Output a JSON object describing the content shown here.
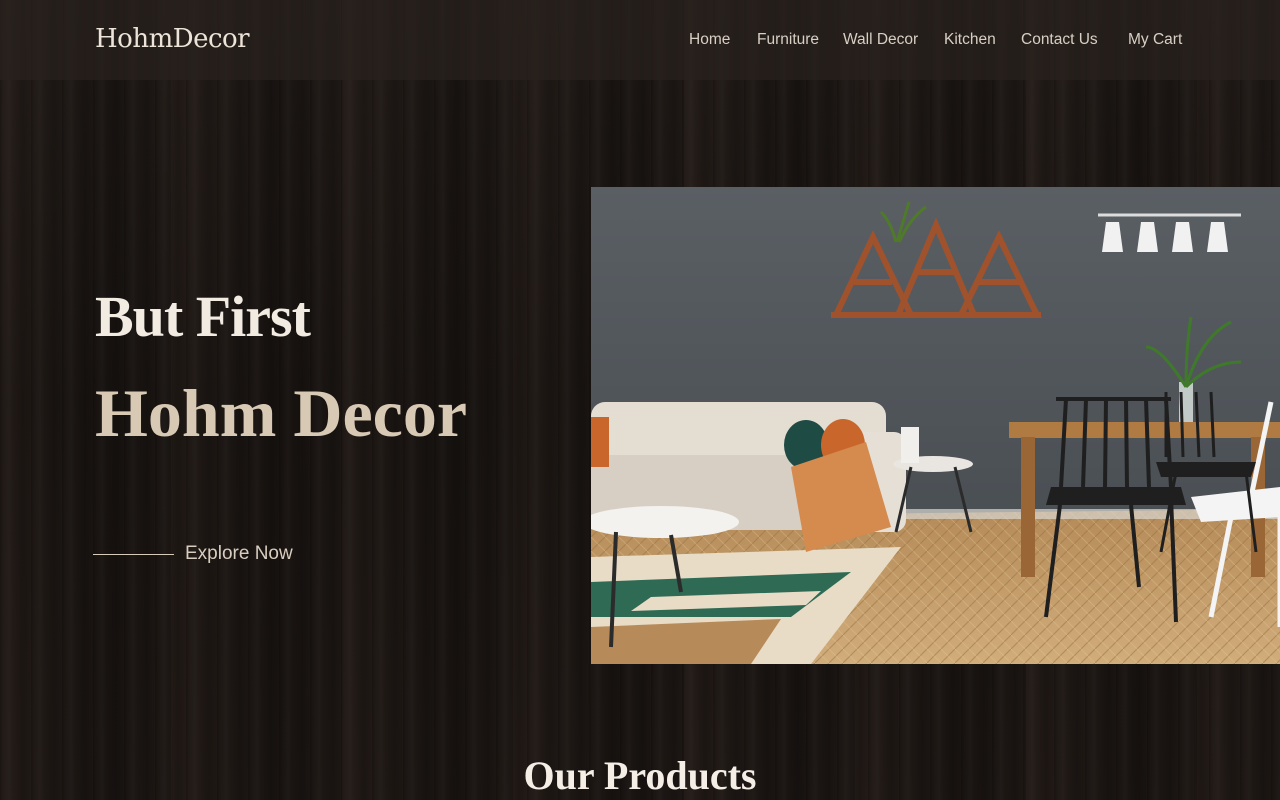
{
  "brand": {
    "logo_text": "HohmDecor"
  },
  "nav": {
    "items": [
      {
        "label": "Home"
      },
      {
        "label": "Furniture"
      },
      {
        "label": "Wall Decor"
      },
      {
        "label": "Kitchen"
      },
      {
        "label": "Contact Us"
      },
      {
        "label": "My Cart"
      }
    ]
  },
  "hero": {
    "title_line1": "But First",
    "title_line2": "Hohm Decor",
    "cta_label": "Explore Now",
    "image_icon": "living-room-photo"
  },
  "products": {
    "heading": "Our Products"
  },
  "colors": {
    "background": "#1c1714",
    "navbar": "#28211d",
    "text_primary": "#f1ebe2",
    "text_accent": "#d8c9b4"
  }
}
